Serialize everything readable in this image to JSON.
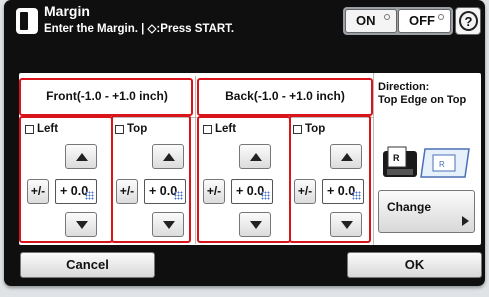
{
  "header": {
    "title": "Margin",
    "subtitle": "Enter the Margin. | ◇:Press START.",
    "on_label": "ON",
    "off_label": "OFF",
    "help_label": "?"
  },
  "sections": {
    "front_label": "Front(-1.0 - +1.0 inch)",
    "back_label": "Back(-1.0 - +1.0 inch)"
  },
  "fields": [
    {
      "label": "Left",
      "value": "+ 0.0",
      "checked": false
    },
    {
      "label": "Top",
      "value": "+ 0.0",
      "checked": false
    },
    {
      "label": "Left",
      "value": "+ 0.0",
      "checked": false
    },
    {
      "label": "Top",
      "value": "+ 0.0",
      "checked": false
    }
  ],
  "plus_minus_label": "+/-",
  "direction": {
    "label": "Direction:\nTop Edge on Top",
    "change_label": "Change"
  },
  "footer": {
    "cancel_label": "Cancel",
    "ok_label": "OK"
  },
  "colors": {
    "highlight": "#d9141b",
    "panel": "#0f0f10"
  }
}
